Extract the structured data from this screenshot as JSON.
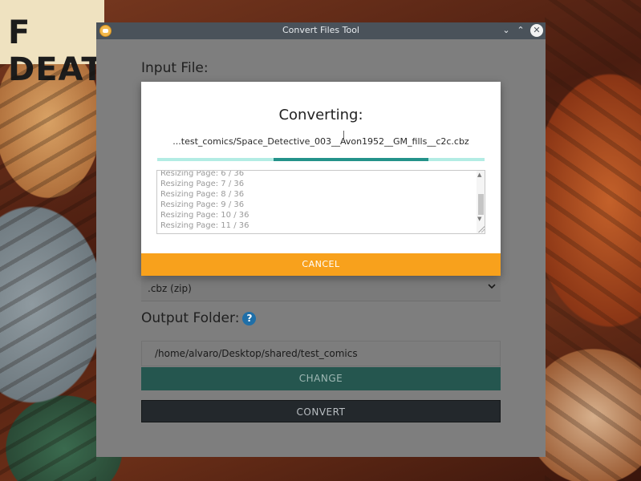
{
  "desktop": {
    "banner_text": "F DEAT"
  },
  "window": {
    "title": "Convert Files Tool",
    "controls": {
      "minimize": "⌄",
      "maximize": "⌃",
      "close": "✕"
    }
  },
  "form": {
    "input_label": "Input File:",
    "format_value": ".cbz (zip)",
    "output_label": "Output Folder:",
    "help_icon": "?",
    "output_path": "/home/alvaro/Desktop/shared/test_comics",
    "change_label": "CHANGE",
    "convert_label": "CONVERT"
  },
  "modal": {
    "heading": "Converting:",
    "file": "...test_comics/Space_Detective_003__Avon1952__GM_fills__c2c.cbz",
    "progress": {
      "start": 0.355,
      "end": 0.829
    },
    "log": [
      "Resizing Page: 6 / 36",
      "Resizing Page: 7 / 36",
      "Resizing Page: 8 / 36",
      "Resizing Page: 9 / 36",
      "Resizing Page: 10 / 36",
      "Resizing Page: 11 / 36"
    ],
    "cancel_label": "CANCEL"
  },
  "colors": {
    "accent_orange": "#f8a11c",
    "teal": "#24928a",
    "teal_light": "#b3ece4",
    "help_blue": "#1f6fa8"
  }
}
